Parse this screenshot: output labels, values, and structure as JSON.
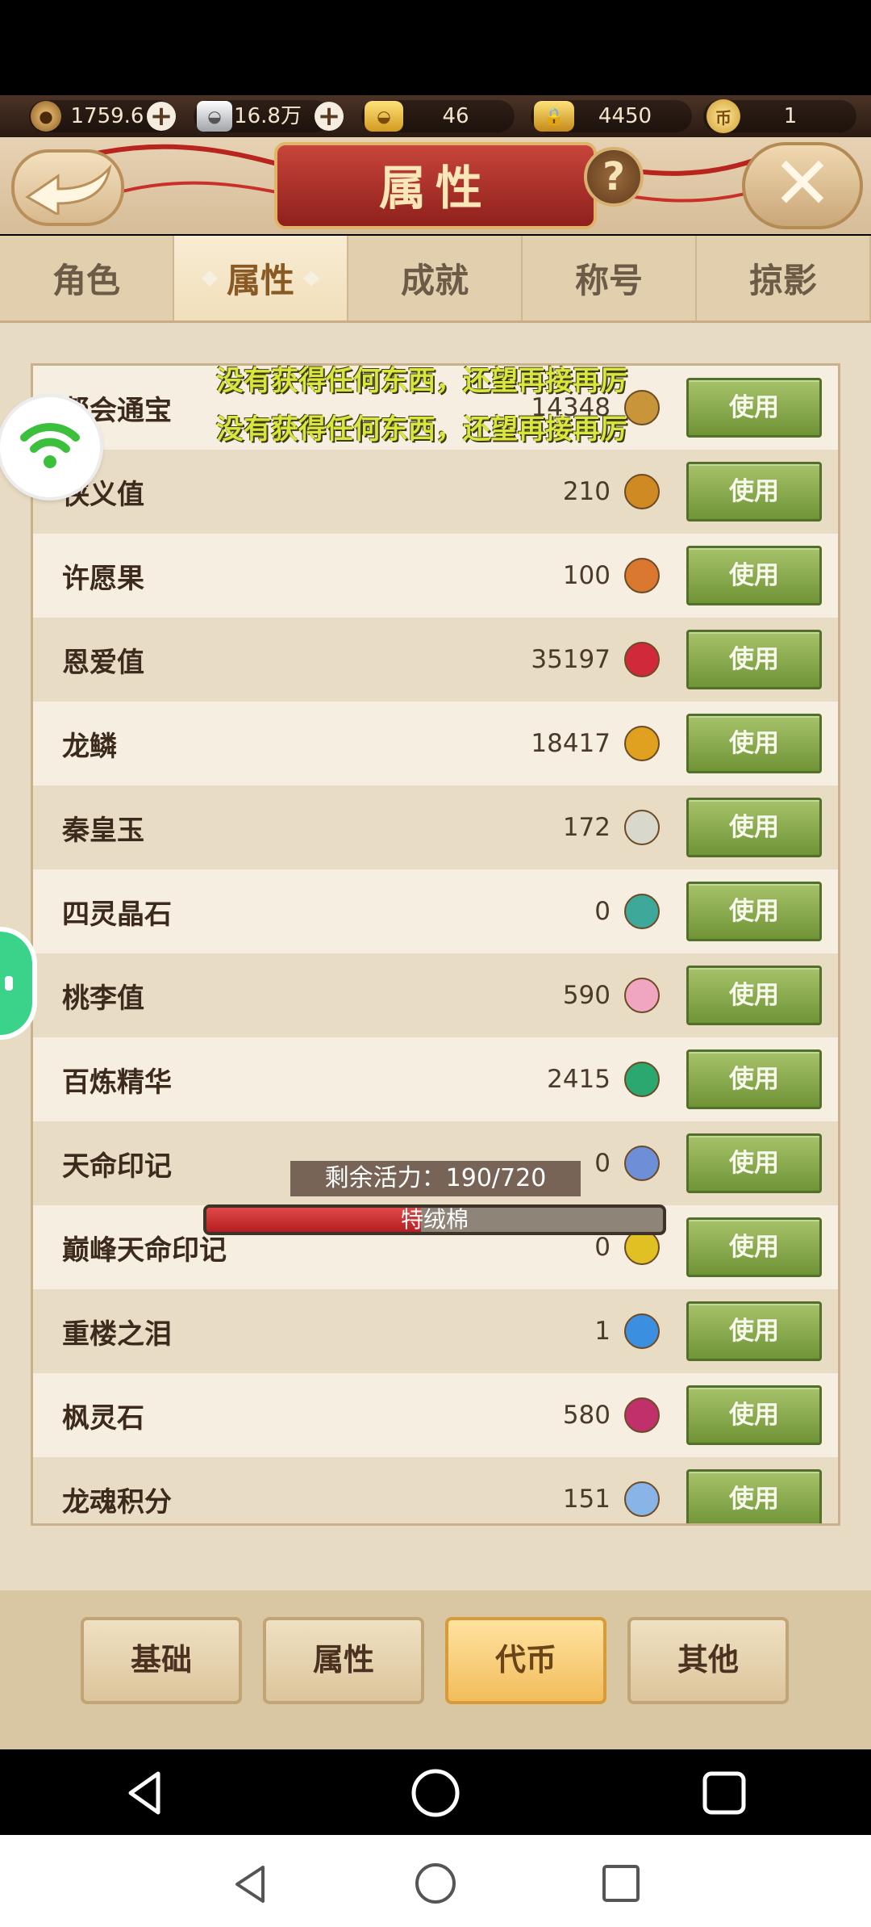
{
  "currency": [
    {
      "icon": "copper-coin-icon",
      "value": "1759.6万",
      "has_plus": true
    },
    {
      "icon": "silver-ingot-icon",
      "value": "16.8万",
      "has_plus": true
    },
    {
      "icon": "gold-ingot-icon",
      "value": "46",
      "has_plus": false
    },
    {
      "icon": "locked-gold-icon",
      "value": "4450",
      "has_plus": false
    },
    {
      "icon": "token-coin-icon",
      "value": "1",
      "has_plus": false
    }
  ],
  "header": {
    "title": "属性",
    "help_label": "?",
    "close_label": "✕"
  },
  "tabs": [
    {
      "label": "角色",
      "active": false
    },
    {
      "label": "属性",
      "active": true
    },
    {
      "label": "成就",
      "active": false
    },
    {
      "label": "称号",
      "active": false
    },
    {
      "label": "掠影",
      "active": false
    }
  ],
  "list": {
    "use_label": "使用",
    "rows": [
      {
        "label": "帮会通宝",
        "value": "14348",
        "icon": "bang-coin-icon"
      },
      {
        "label": "侠义值",
        "value": "210",
        "icon": "xia-badge-icon"
      },
      {
        "label": "许愿果",
        "value": "100",
        "icon": "wish-fruit-icon"
      },
      {
        "label": "恩爱值",
        "value": "35197",
        "icon": "heart-icon"
      },
      {
        "label": "龙鳞",
        "value": "18417",
        "icon": "dragon-scale-icon"
      },
      {
        "label": "秦皇玉",
        "value": "172",
        "icon": "jade-tag-icon"
      },
      {
        "label": "四灵晶石",
        "value": "0",
        "icon": "crystal-icon"
      },
      {
        "label": "桃李值",
        "value": "590",
        "icon": "peach-blossom-icon"
      },
      {
        "label": "百炼精华",
        "value": "2415",
        "icon": "green-gem-icon"
      },
      {
        "label": "天命印记",
        "value": "0",
        "icon": "blue-seal-icon"
      },
      {
        "label": "巅峰天命印记",
        "value": "0",
        "icon": "gold-seal-icon"
      },
      {
        "label": "重楼之泪",
        "value": "1",
        "icon": "water-drop-icon"
      },
      {
        "label": "枫灵石",
        "value": "580",
        "icon": "maple-stone-icon"
      },
      {
        "label": "龙魂积分",
        "value": "151",
        "icon": "dragon-soul-icon"
      }
    ]
  },
  "overlay": {
    "message_1": "没有获得任何东西，还望再接再厉",
    "message_2": "没有获得任何东西，还望再接再厉",
    "vitality_text": "剩余活力：190/720",
    "progress_label": "特绒棉",
    "progress_fraction": 0.47
  },
  "bottom_tabs": [
    {
      "label": "基础",
      "active": false
    },
    {
      "label": "属性",
      "active": false
    },
    {
      "label": "代币",
      "active": true
    },
    {
      "label": "其他",
      "active": false
    }
  ],
  "colors": {
    "use_button": "#7fa443",
    "title_plaque": "#b3332c",
    "active_bottom": "#f2bd5b",
    "float_message": "#d9e63d"
  }
}
